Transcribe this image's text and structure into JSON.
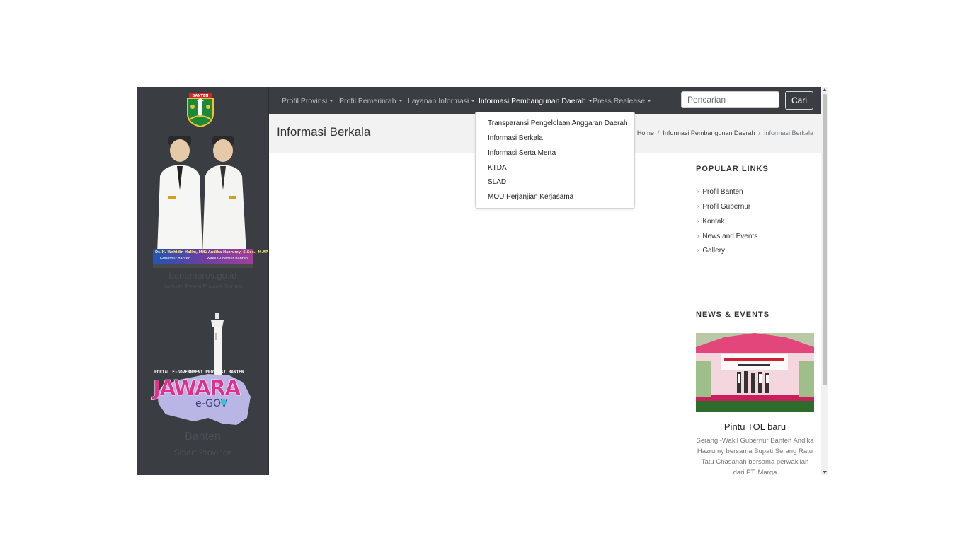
{
  "sidebar": {
    "emblem_text": "BANTEN",
    "leaders": {
      "governor_name": "Dr. H. Wahidin Halim, M.Si",
      "governor_title": "Gubernur Banten",
      "vice_name": "H. Andika Hazrumy, S.Sos., M.AP",
      "vice_title": "Wakil Gubernur Banten"
    },
    "site_domain": "bantenprov.go.id",
    "site_tagline": "Website Resmi Provinsi Banten",
    "jawara_caption": "PORTAL E-GOVERNMENT PROVINSI BANTEN",
    "jawara_logo": "JAWARA",
    "jawara_sub": "e-GOV",
    "region": "Banten",
    "region_tagline": "Smart Province"
  },
  "navbar": {
    "items": [
      {
        "label": "Profil Provinsi"
      },
      {
        "label": "Profil Pemerintah"
      },
      {
        "label": "Layanan Informasi"
      },
      {
        "label": "Informasi Pembangunan Daerah"
      },
      {
        "label": "Press Realease"
      }
    ],
    "search_placeholder": "Pencarian",
    "search_button": "Cari"
  },
  "dropdown": {
    "items": [
      "Transparansi Pengelolaan Anggaran Daerah",
      "Informasi Berkala",
      "Informasi Serta Merta",
      "KTDA",
      "SLAD",
      "MOU Perjanjian Kerjasama"
    ]
  },
  "page": {
    "title": "Informasi Berkala",
    "breadcrumb": [
      "Home",
      "Informasi Pembangunan Daerah",
      "Informasi Berkala"
    ]
  },
  "popular_links": {
    "heading": "POPULAR LINKS",
    "items": [
      "Profil Banten",
      "Profil Gubernur",
      "Kontak",
      "News and Events",
      "Gallery"
    ]
  },
  "news_events": {
    "heading": "NEWS & EVENTS",
    "title": "Pintu TOL baru",
    "body": "Serang -Wakil Gubernur Banten Andika Hazrumy bersama Bupati Serang Ratu Tatu Chasanah bersama perwakilan dari PT. Marga"
  }
}
